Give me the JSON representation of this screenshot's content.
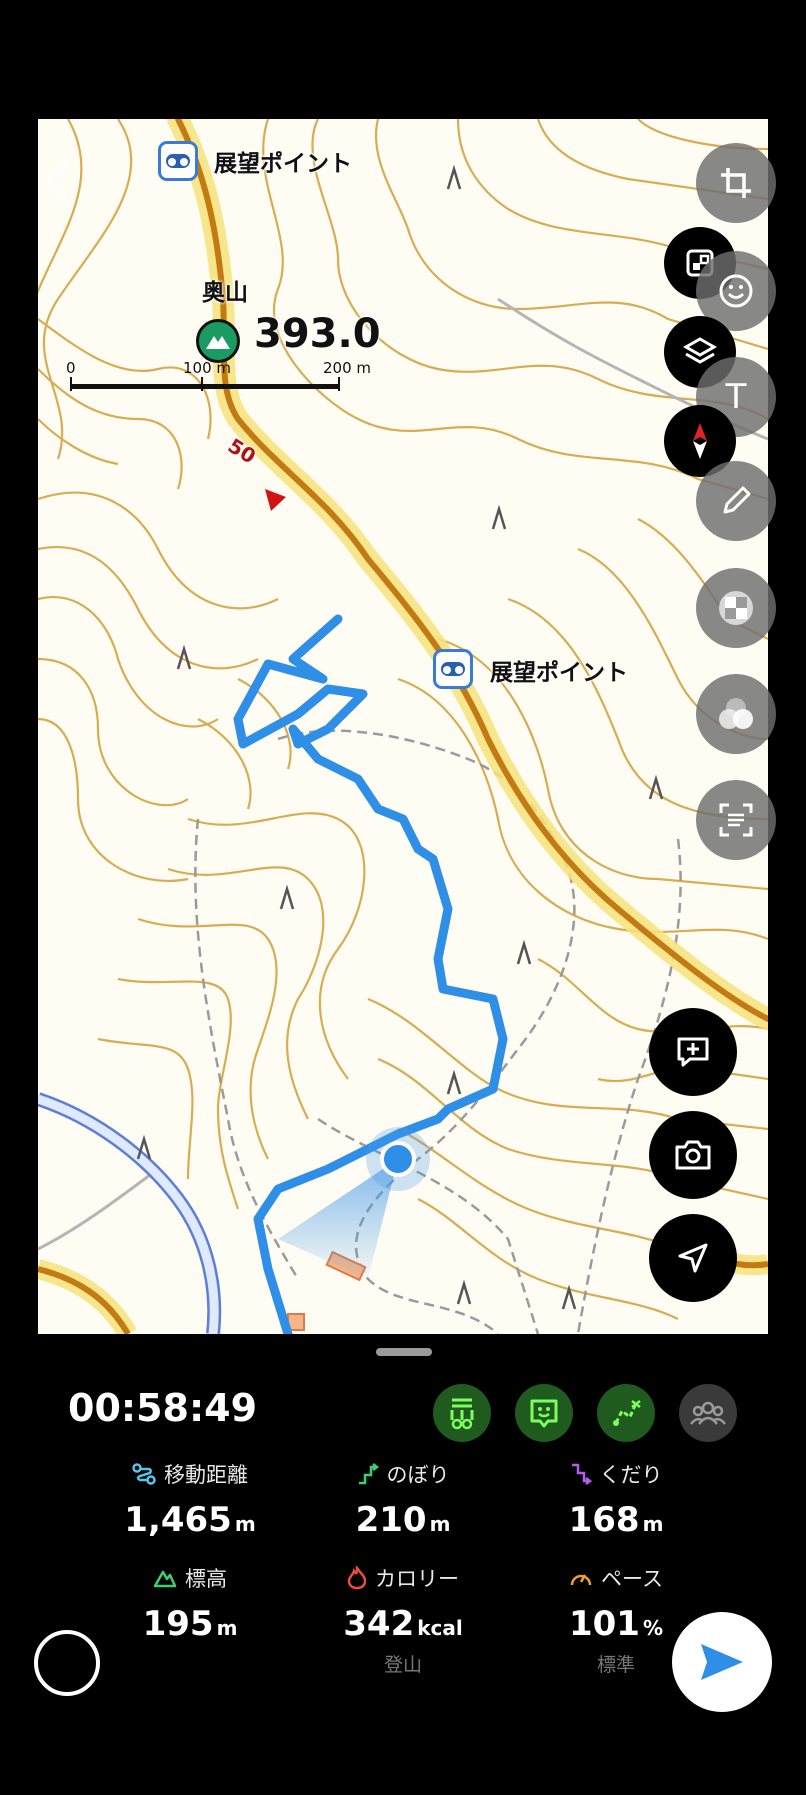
{
  "map": {
    "poi_top_label": "展望ポイント",
    "poi_mid_label": "展望ポイント",
    "peak_name": "奥山",
    "peak_elevation": "393.0",
    "route_number": "50",
    "scale": {
      "tick_0": "0",
      "tick_1": "100 m",
      "tick_2": "200 m"
    }
  },
  "icons": {
    "back": "chevron-left-icon",
    "crop": "crop-icon",
    "map_marker": "map-marker-icon",
    "emoji": "smiley-icon",
    "layers": "layers-icon",
    "text": "text-icon",
    "compass": "compass-icon",
    "pen": "pen-icon",
    "mosaic": "mosaic-icon",
    "blur": "blur-icon",
    "scan": "scan-text-icon",
    "add_note": "add-note-icon",
    "camera": "camera-icon",
    "navigate": "navigation-arrow-icon"
  },
  "toolbar": {
    "text_tool_label": "T"
  },
  "panel": {
    "timer": "00:58:49",
    "stats": [
      {
        "label": "移動距離",
        "value": "1,465",
        "unit": "m",
        "sub": ""
      },
      {
        "label": "のぼり",
        "value": "210",
        "unit": "m",
        "sub": ""
      },
      {
        "label": "くだり",
        "value": "168",
        "unit": "m",
        "sub": ""
      },
      {
        "label": "標高",
        "value": "195",
        "unit": "m",
        "sub": ""
      },
      {
        "label": "カロリー",
        "value": "342",
        "unit": "kcal",
        "sub": "登山"
      },
      {
        "label": "ペース",
        "value": "101",
        "unit": "%",
        "sub": "標準"
      }
    ]
  },
  "colors": {
    "track": "#2f8fe6",
    "contour": "#c99a2e",
    "trail": "#c47a12",
    "trail_glow": "#f7e27a",
    "chip_green": "#1f5a1f",
    "send": "#2f8fe6"
  }
}
